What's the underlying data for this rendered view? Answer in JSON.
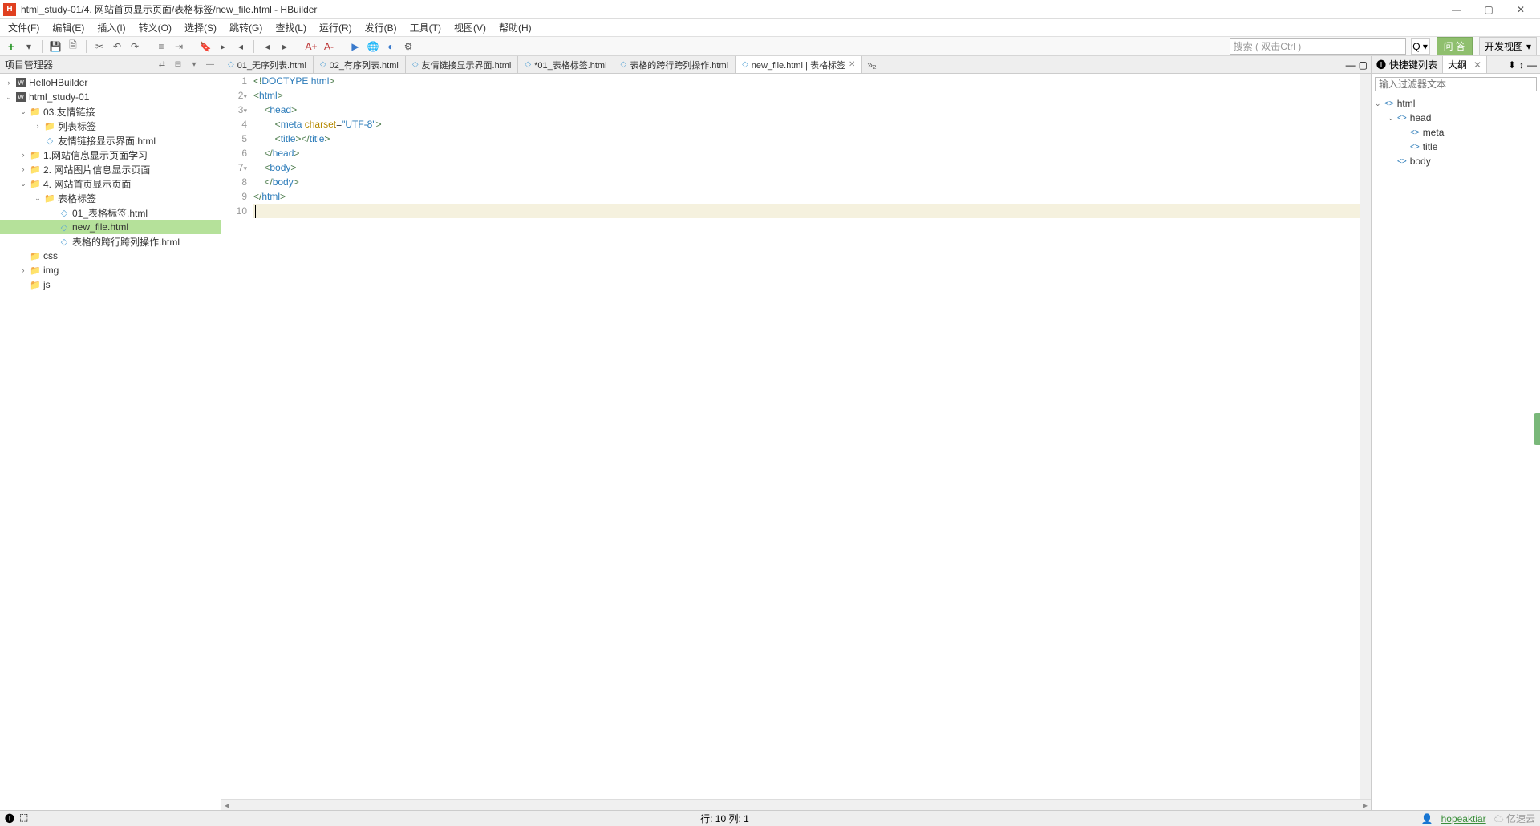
{
  "window": {
    "title": "html_study-01/4. 网站首页显示页面/表格标签/new_file.html  -  HBuilder",
    "app_icon_letter": "H"
  },
  "menus": [
    "文件(F)",
    "编辑(E)",
    "插入(I)",
    "转义(O)",
    "选择(S)",
    "跳转(G)",
    "查找(L)",
    "运行(R)",
    "发行(B)",
    "工具(T)",
    "视图(V)",
    "帮助(H)"
  ],
  "toolbar": {
    "search_placeholder": "搜索 ( 双击Ctrl )",
    "green_button": "问 答",
    "dev_view": "开发视图"
  },
  "left_panel": {
    "title": "项目管理器",
    "tree": [
      {
        "depth": 0,
        "arrow": ">",
        "icon": "W",
        "label": "HelloHBuilder"
      },
      {
        "depth": 0,
        "arrow": "v",
        "icon": "W",
        "label": "html_study-01"
      },
      {
        "depth": 1,
        "arrow": "v",
        "icon": "fld",
        "label": "03.友情链接"
      },
      {
        "depth": 2,
        "arrow": ">",
        "icon": "fld",
        "label": "列表标签"
      },
      {
        "depth": 2,
        "arrow": "",
        "icon": "fil",
        "label": "友情链接显示界面.html"
      },
      {
        "depth": 1,
        "arrow": ">",
        "icon": "fld",
        "label": "1.网站信息显示页面学习"
      },
      {
        "depth": 1,
        "arrow": ">",
        "icon": "fld",
        "label": "2. 网站图片信息显示页面"
      },
      {
        "depth": 1,
        "arrow": "v",
        "icon": "fld",
        "label": "4. 网站首页显示页面"
      },
      {
        "depth": 2,
        "arrow": "v",
        "icon": "fld",
        "label": "表格标签"
      },
      {
        "depth": 3,
        "arrow": "",
        "icon": "fil",
        "label": "01_表格标签.html"
      },
      {
        "depth": 3,
        "arrow": "",
        "icon": "fil",
        "label": "new_file.html",
        "selected": true
      },
      {
        "depth": 3,
        "arrow": "",
        "icon": "fil",
        "label": "表格的跨行跨列操作.html"
      },
      {
        "depth": 1,
        "arrow": "",
        "icon": "fld",
        "label": "css"
      },
      {
        "depth": 1,
        "arrow": ">",
        "icon": "fld",
        "label": "img"
      },
      {
        "depth": 1,
        "arrow": "",
        "icon": "fld",
        "label": "js"
      }
    ]
  },
  "editor_tabs": [
    {
      "label": "01_无序列表.html"
    },
    {
      "label": "02_有序列表.html"
    },
    {
      "label": "友情链接显示界面.html"
    },
    {
      "label": "*01_表格标签.html"
    },
    {
      "label": "表格的跨行跨列操作.html"
    },
    {
      "label": "new_file.html | 表格标签",
      "active": true,
      "closable": true
    }
  ],
  "tab_overflow": "»₂",
  "code": {
    "lines": [
      {
        "n": 1,
        "fold": "",
        "html": "<span class='tag-brkt'>&lt;!</span><span class='doctype'>DOCTYPE</span> <span class='tag-name'>html</span><span class='tag-brkt'>&gt;</span>"
      },
      {
        "n": 2,
        "fold": "▾",
        "html": "<span class='tag-brkt'>&lt;</span><span class='tag-name'>html</span><span class='tag-brkt'>&gt;</span>"
      },
      {
        "n": 3,
        "fold": "▾",
        "html": "    <span class='tag-brkt'>&lt;</span><span class='tag-name'>head</span><span class='tag-brkt'>&gt;</span>"
      },
      {
        "n": 4,
        "fold": "",
        "html": "        <span class='tag-brkt'>&lt;</span><span class='tag-name'>meta</span> <span class='attr-name'>charset</span>=<span class='attr-val'>\"UTF-8\"</span><span class='tag-brkt'>&gt;</span>"
      },
      {
        "n": 5,
        "fold": "",
        "html": "        <span class='tag-brkt'>&lt;</span><span class='tag-name'>title</span><span class='tag-brkt'>&gt;&lt;/</span><span class='tag-name'>title</span><span class='tag-brkt'>&gt;</span>"
      },
      {
        "n": 6,
        "fold": "",
        "html": "    <span class='tag-brkt'>&lt;/</span><span class='tag-name'>head</span><span class='tag-brkt'>&gt;</span>"
      },
      {
        "n": 7,
        "fold": "▾",
        "html": "    <span class='tag-brkt'>&lt;</span><span class='tag-name'>body</span><span class='tag-brkt'>&gt;</span>"
      },
      {
        "n": 8,
        "fold": "",
        "html": "    <span class='tag-brkt'>&lt;/</span><span class='tag-name'>body</span><span class='tag-brkt'>&gt;</span>"
      },
      {
        "n": 9,
        "fold": "",
        "html": "<span class='tag-brkt'>&lt;/</span><span class='tag-name'>html</span><span class='tag-brkt'>&gt;</span>"
      },
      {
        "n": 10,
        "fold": "",
        "html": "<span class='cursor'></span>",
        "cursor": true
      }
    ]
  },
  "right_panel": {
    "tab1": "快捷键列表",
    "tab2": "大纲",
    "filter_placeholder": "输入过滤器文本",
    "outline": [
      {
        "depth": 0,
        "arrow": "v",
        "label": "html"
      },
      {
        "depth": 1,
        "arrow": "v",
        "label": "head"
      },
      {
        "depth": 2,
        "arrow": "",
        "label": "meta"
      },
      {
        "depth": 2,
        "arrow": "",
        "label": "title"
      },
      {
        "depth": 1,
        "arrow": "",
        "label": "body"
      }
    ]
  },
  "statusbar": {
    "position": "行: 10 列: 1",
    "user": "hopeaktiar",
    "cloud": "亿速云"
  }
}
